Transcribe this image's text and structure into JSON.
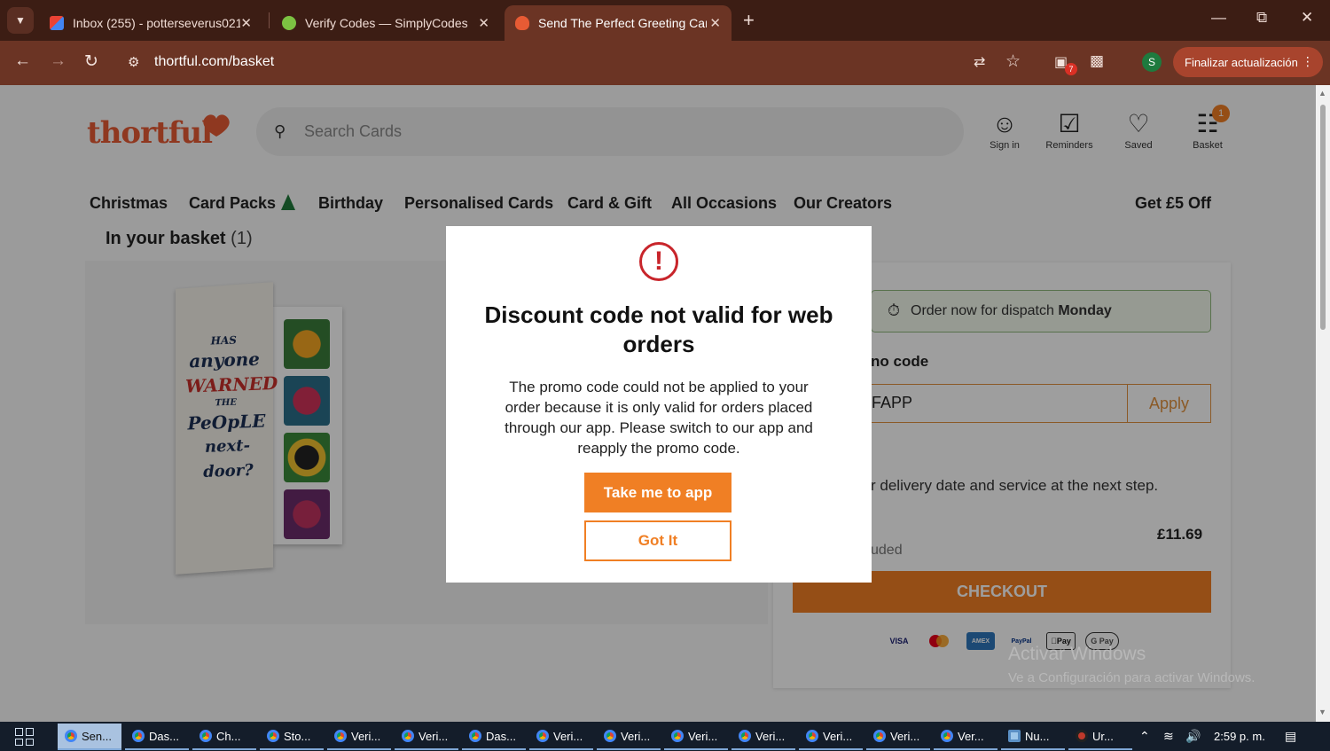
{
  "browser": {
    "tabs": [
      {
        "title": "Inbox (255) - potterseverus021(",
        "active": false
      },
      {
        "title": "Verify Codes — SimplyCodes",
        "active": false
      },
      {
        "title": "Send The Perfect Greeting Card",
        "active": true
      }
    ],
    "url": "thortful.com/basket",
    "update_label": "Finalizar actualización",
    "profile_initial": "S",
    "extension_badge": "7"
  },
  "header": {
    "logo": "thortful",
    "search_placeholder": "Search Cards",
    "actions": [
      {
        "label": "Sign in",
        "icon": "user-icon"
      },
      {
        "label": "Reminders",
        "icon": "calendar-check-icon"
      },
      {
        "label": "Saved",
        "icon": "heart-icon"
      },
      {
        "label": "Basket",
        "icon": "basket-icon"
      }
    ],
    "basket_count": "1"
  },
  "nav": {
    "items": [
      "Christmas",
      "Card Packs",
      "Birthday",
      "Personalised Cards",
      "Card & Gift",
      "All Occasions",
      "Our Creators"
    ],
    "promo": "Get £5 Off"
  },
  "basket": {
    "title": "In your basket",
    "count": "(1)"
  },
  "card": {
    "line1": "HAS",
    "line2": "anyone",
    "line3": "WARNED",
    "line4": "THE",
    "line5": "PeOpLE",
    "line6": "next-door?"
  },
  "summary": {
    "dispatch_prefix": "Order now for dispatch",
    "dispatch_day": "Monday",
    "promo_label": "no code",
    "promo_value": "FAPP",
    "apply_label": "Apply",
    "delivery_note": "r delivery date and service at the next step.",
    "price": "£11.69",
    "vat_note": "uded",
    "checkout_label": "CHECKOUT",
    "payment_methods": [
      "VISA",
      "Mastercard",
      "AMEX",
      "PayPal",
      "Pay",
      "G Pay"
    ]
  },
  "modal": {
    "title": "Discount code not valid for web orders",
    "body": "The promo code could not be applied to your order because it is only valid for orders placed through our app. Please switch to our app and reapply the promo code.",
    "primary_label": "Take me to app",
    "secondary_label": "Got It"
  },
  "watermark": {
    "line1": "Activar Windows",
    "line2": "Ve a Configuración para activar Windows."
  },
  "taskbar": {
    "items": [
      "Sen...",
      "Das...",
      "Ch...",
      "Sto...",
      "Veri...",
      "Veri...",
      "Das...",
      "Veri...",
      "Veri...",
      "Veri...",
      "Veri...",
      "Veri...",
      "Veri...",
      "Ver...",
      "Nu...",
      "Ur..."
    ],
    "time": "2:59 p. m."
  }
}
